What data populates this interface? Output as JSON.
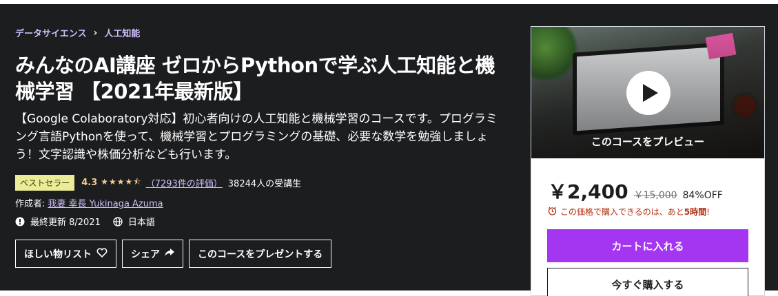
{
  "breadcrumb": {
    "items": [
      "データサイエンス",
      "人工知能"
    ],
    "separator": "›"
  },
  "course": {
    "title": "みんなのAI講座 ゼロからPythonで学ぶ人工知能と機械学習 【2021年最新版】",
    "subtitle": "【Google Colaboratory対応】初心者向けの人工知能と機械学習のコースです。プログラミング言語Pythonを使って、機械学習とプログラミングの基礎、必要な数学を勉強しましょう！文字認識や株価分析なども行います。",
    "badge": "ベストセラー",
    "rating": "4.3",
    "stars": "★★★★⯪",
    "rating_count": "（7293件の評価）",
    "students": "38244人の受講生",
    "author_label": "作成者:",
    "author": "我妻 幸長 Yukinaga Azuma",
    "last_updated": "最終更新 8/2021",
    "language": "日本語"
  },
  "actions": {
    "wishlist": "ほしい物リスト",
    "share": "シェア",
    "gift": "このコースをプレゼントする"
  },
  "sidebar": {
    "preview_label": "このコースをプレビュー",
    "price": "￥2,400",
    "original_price": "￥15,000",
    "discount": "84%OFF",
    "timer_text": "この価格で購入できるのは、あと",
    "timer_remaining": "5時間",
    "timer_suffix": "!",
    "add_to_cart": "カートに入れる",
    "buy_now": "今すぐ購入する"
  },
  "colors": {
    "hero_bg": "#1c1d1f",
    "accent": "#a435f0",
    "link": "#cec0fc",
    "star": "#f3ca8c",
    "badge_bg": "#eceb98",
    "alert": "#b32d0f"
  }
}
